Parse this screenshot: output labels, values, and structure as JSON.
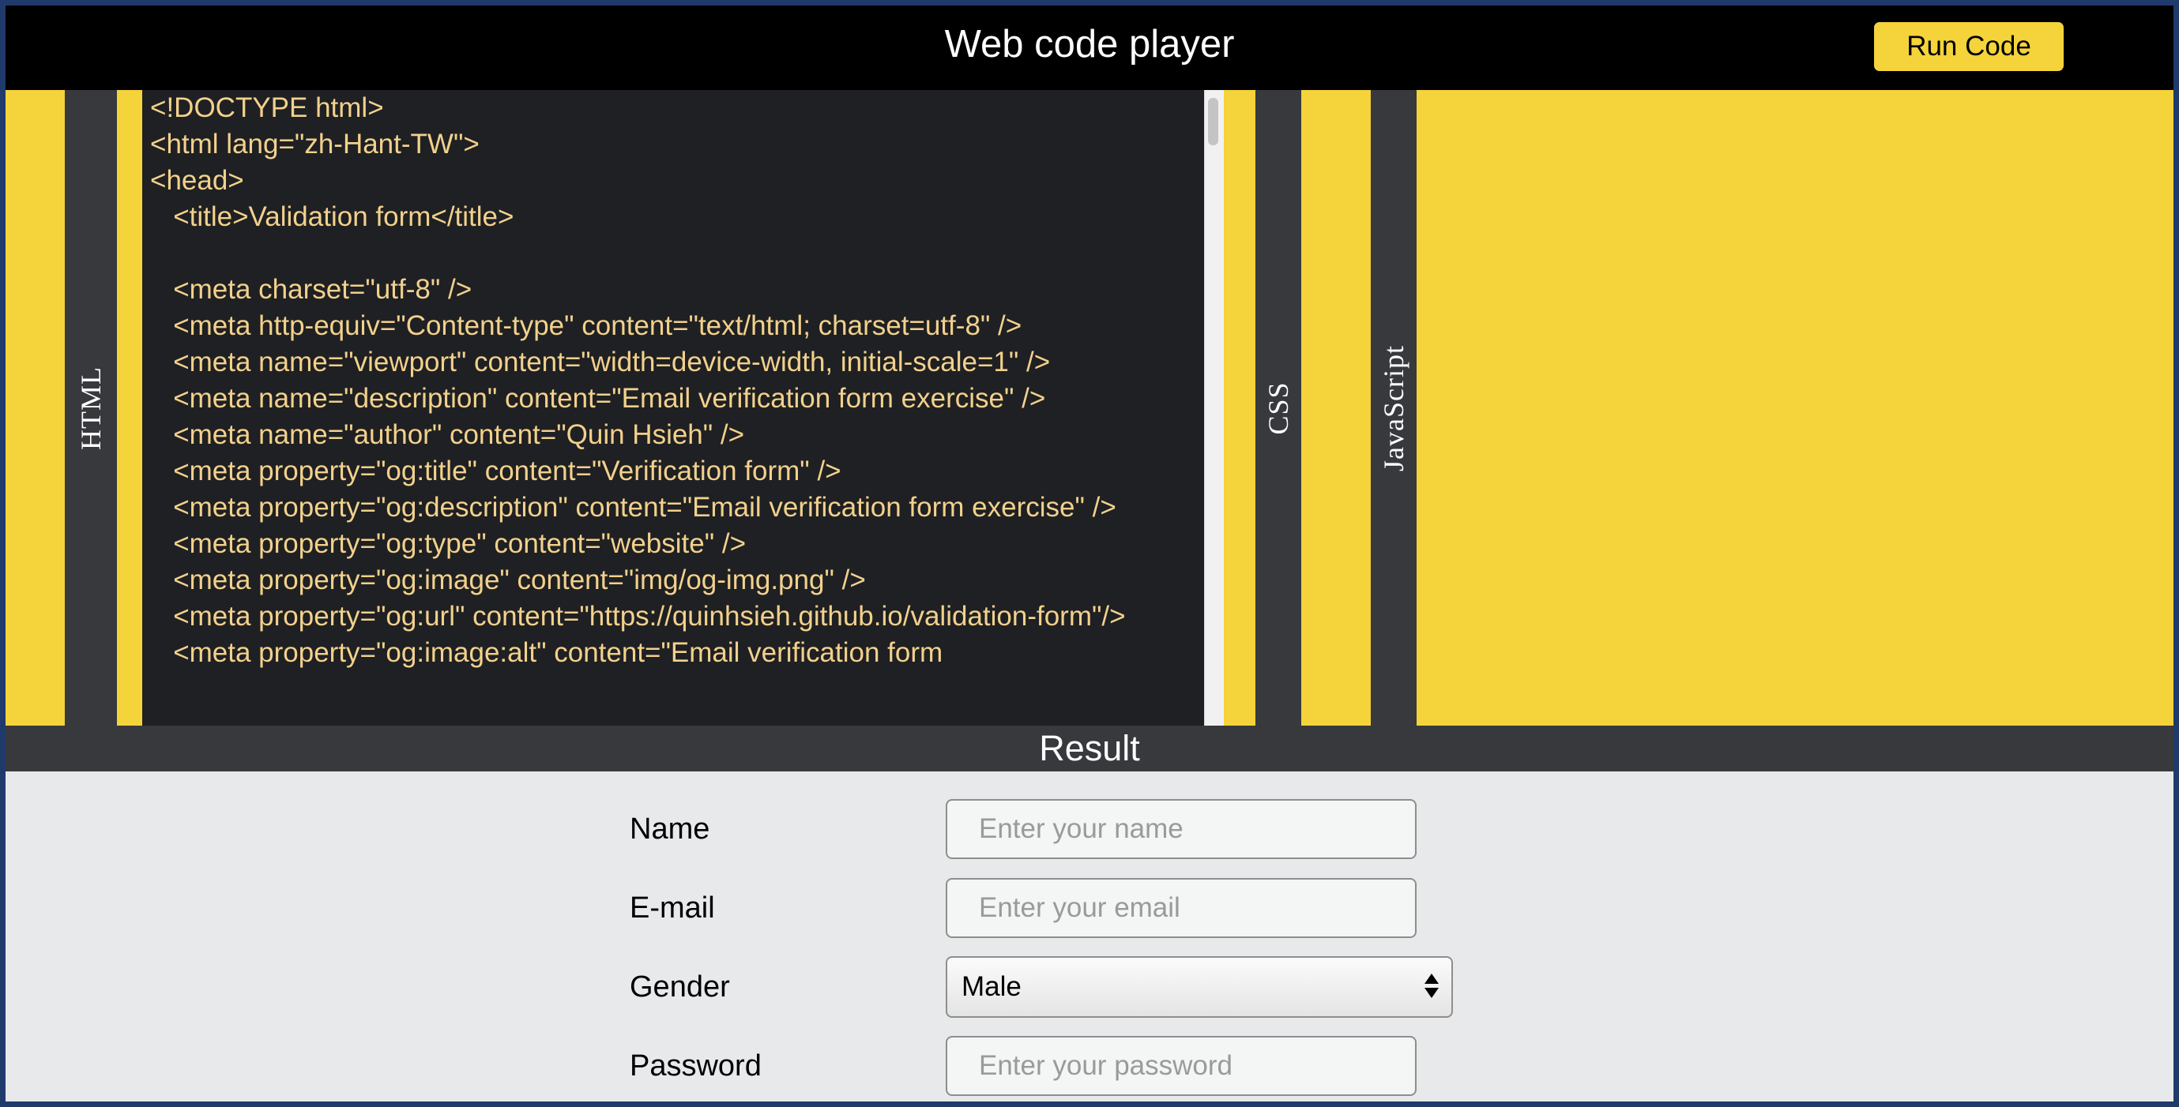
{
  "header": {
    "title": "Web code player",
    "run_button": "Run Code"
  },
  "tabs": {
    "html": "HTML",
    "css": "CSS",
    "javascript": "JavaScript"
  },
  "html_editor": {
    "lines": [
      "<!DOCTYPE html>",
      "<html lang=\"zh-Hant-TW\">",
      "<head>",
      "   <title>Validation form</title>",
      "",
      "   <meta charset=\"utf-8\" />",
      "   <meta http-equiv=\"Content-type\" content=\"text/html; charset=utf-8\" />",
      "   <meta name=\"viewport\" content=\"width=device-width, initial-scale=1\" />",
      "   <meta name=\"description\" content=\"Email verification form exercise\" />",
      "   <meta name=\"author\" content=\"Quin Hsieh\" />",
      "   <meta property=\"og:title\" content=\"Verification form\" />",
      "   <meta property=\"og:description\" content=\"Email verification form exercise\" />",
      "   <meta property=\"og:type\" content=\"website\" />",
      "   <meta property=\"og:image\" content=\"img/og-img.png\" />",
      "   <meta property=\"og:url\" content=\"https://quinhsieh.github.io/validation-form\"/>",
      "   <meta property=\"og:image:alt\" content=\"Email verification form"
    ]
  },
  "result": {
    "title": "Result",
    "name_label": "Name",
    "name_placeholder": "Enter your name",
    "email_label": "E-mail",
    "email_placeholder": "Enter your email",
    "gender_label": "Gender",
    "gender_value": "Male",
    "password_label": "Password",
    "password_placeholder": "Enter your password"
  }
}
